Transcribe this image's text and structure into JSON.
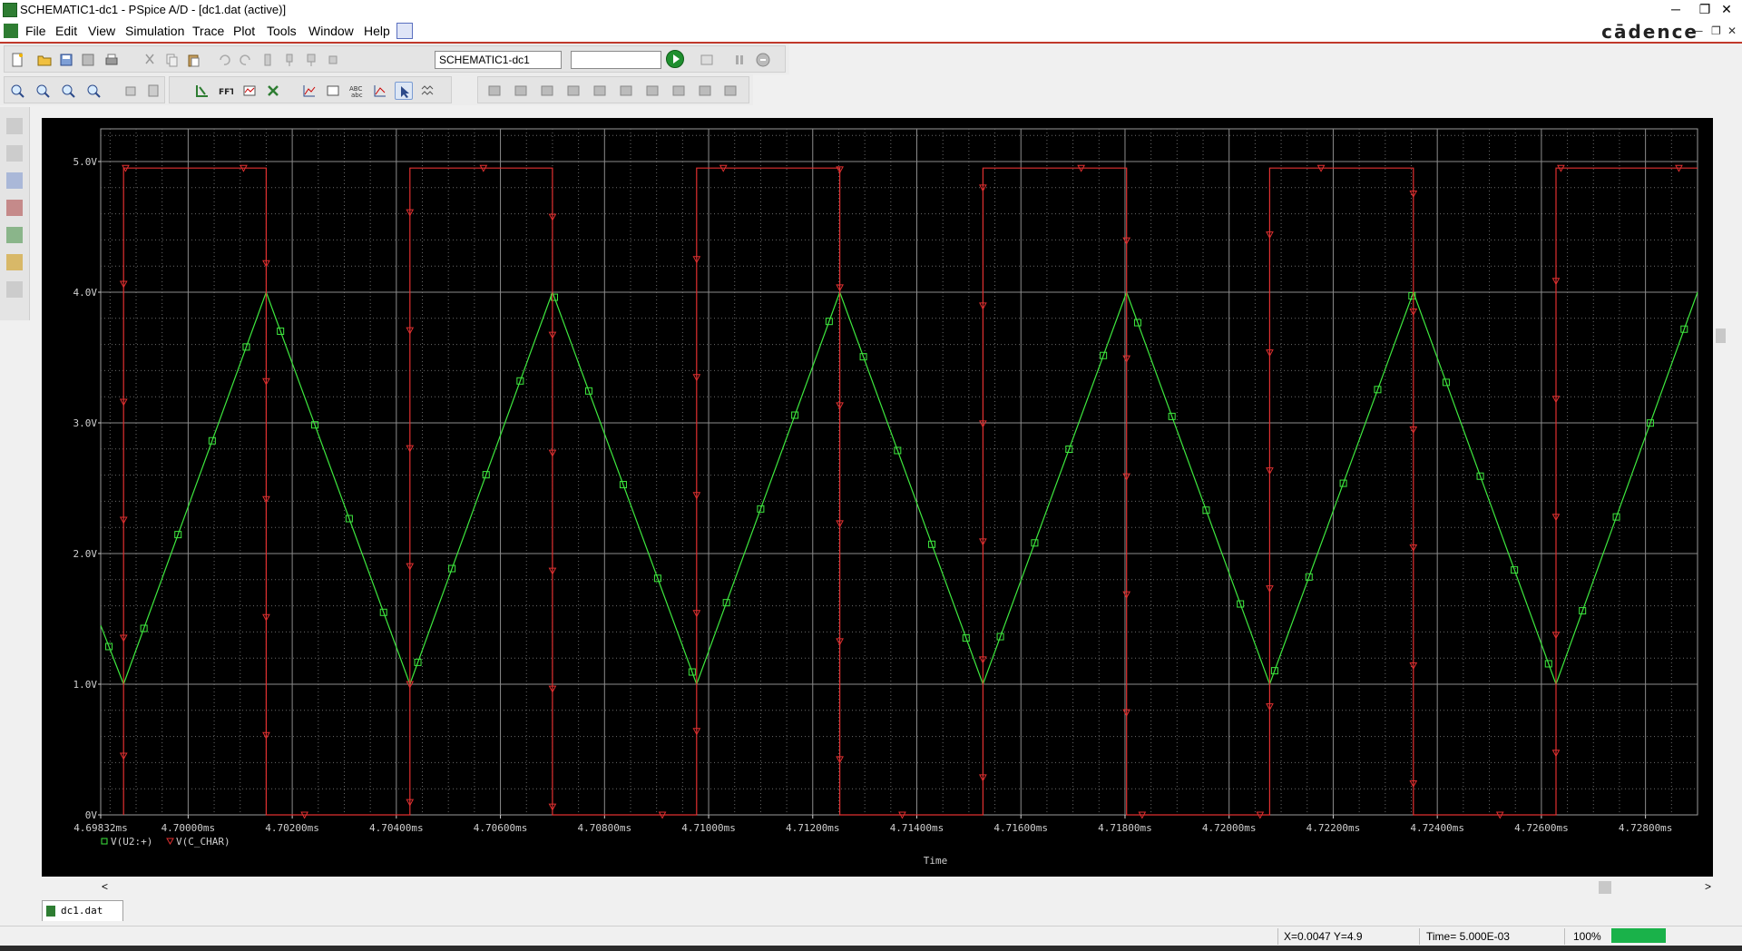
{
  "window": {
    "title": "SCHEMATIC1-dc1 - PSpice A/D  - [dc1.dat (active)]",
    "minimize": "─",
    "restore": "❐",
    "close": "✕"
  },
  "menu": {
    "items": [
      "File",
      "Edit",
      "View",
      "Simulation",
      "Trace",
      "Plot",
      "Tools",
      "Window",
      "Help"
    ],
    "brand": "cādence",
    "mdi_minimize": "─",
    "mdi_restore": "❐",
    "mdi_close": "✕"
  },
  "toolbar": {
    "simulation_profile": "SCHEMATIC1-dc1",
    "secondary_combo": "",
    "icons_row1": [
      "new-icon",
      "open-icon",
      "save-as-icon",
      "save-icon",
      "print-icon",
      "cut-icon",
      "copy-icon",
      "paste-icon",
      "undo-icon",
      "redo-icon"
    ],
    "icons_row2": [
      "zoom-in-icon",
      "zoom-out-icon",
      "zoom-area-icon",
      "zoom-fit-icon",
      "log-x-icon",
      "add-trace-icon",
      "fft-icon",
      "performance-icon",
      "delete-trace-icon",
      "add-plot-icon",
      "text-label-icon",
      "abc-icon",
      "toggle-cursor-icon",
      "select-icon",
      "mark-data-icon"
    ]
  },
  "chart_data": {
    "type": "line",
    "xlabel": "Time",
    "ylabel": "",
    "xlim": [
      4.69832,
      4.729
    ],
    "ylim": [
      0,
      5.25
    ],
    "x_unit": "ms",
    "y_ticks": [
      "0V",
      "1.0V",
      "2.0V",
      "3.0V",
      "4.0V",
      "5.0V"
    ],
    "x_ticks": [
      "4.69832ms",
      "4.70000ms",
      "4.70200ms",
      "4.70400ms",
      "4.70600ms",
      "4.70800ms",
      "4.71000ms",
      "4.71200ms",
      "4.71400ms",
      "4.71600ms",
      "4.71800ms",
      "4.72000ms",
      "4.72200ms",
      "4.72400ms",
      "4.72600ms",
      "4.72800ms"
    ],
    "grid": true,
    "legend_position": "bottom-left",
    "series": [
      {
        "name": "V(U2:+)",
        "color": "#3ee83e",
        "marker": "square",
        "x": [
          4.69832,
          4.69876,
          4.7015,
          4.70426,
          4.707,
          4.70977,
          4.71252,
          4.71527,
          4.71803,
          4.72078,
          4.72354,
          4.72628,
          4.729
        ],
        "y": [
          1.45,
          1.0,
          4.0,
          1.0,
          4.0,
          1.0,
          4.0,
          1.0,
          4.0,
          1.0,
          4.0,
          1.0,
          4.0
        ]
      },
      {
        "name": "V(C_CHAR)",
        "color": "#e03030",
        "marker": "triangle",
        "x": [
          4.69876,
          4.69876,
          4.7015,
          4.7015,
          4.70426,
          4.70426,
          4.707,
          4.707,
          4.70977,
          4.70977,
          4.71252,
          4.71252,
          4.71527,
          4.71527,
          4.71803,
          4.71803,
          4.72078,
          4.72078,
          4.72354,
          4.72354,
          4.72628,
          4.72628,
          4.729
        ],
        "y": [
          0,
          4.95,
          4.95,
          0,
          0,
          4.95,
          4.95,
          0,
          0,
          4.95,
          4.95,
          0,
          0,
          4.95,
          4.95,
          0,
          0,
          4.95,
          4.95,
          0,
          0,
          4.95,
          4.95
        ]
      }
    ]
  },
  "document_tab": "dc1.dat ...",
  "status": {
    "cursor": "X=0.0047  Y=4.9",
    "time": "Time= 5.000E-03",
    "zoom": "100%"
  },
  "scroll": {
    "left_arrow": "<",
    "right_arrow": ">"
  }
}
